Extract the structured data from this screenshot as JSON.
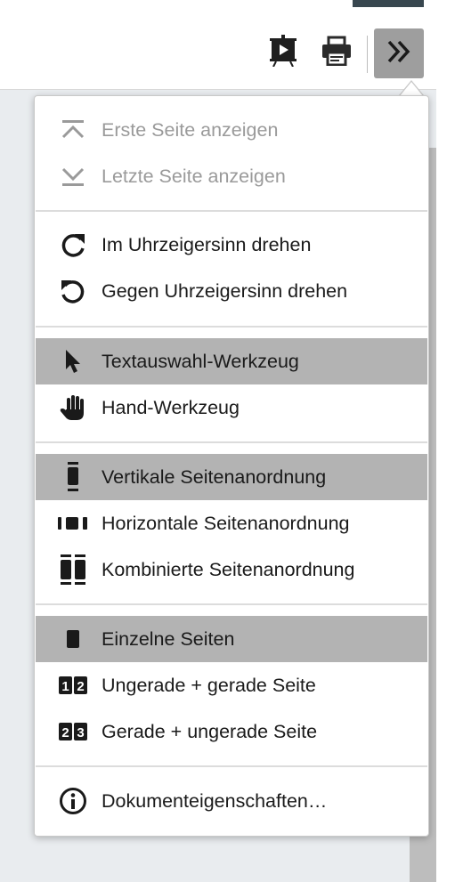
{
  "toolbar": {
    "presentation_icon": "presentation-icon",
    "print_icon": "print-icon",
    "more_icon": "double-chevron-right-icon"
  },
  "menu": {
    "items": [
      {
        "label": "Erste Seite anzeigen",
        "icon": "first-page-icon",
        "disabled": true,
        "active": false
      },
      {
        "label": "Letzte Seite anzeigen",
        "icon": "last-page-icon",
        "disabled": true,
        "active": false
      },
      {
        "label": "Im Uhrzeigersinn drehen",
        "icon": "rotate-clockwise-icon",
        "disabled": false,
        "active": false
      },
      {
        "label": "Gegen Uhrzeigersinn drehen",
        "icon": "rotate-counterclockwise-icon",
        "disabled": false,
        "active": false
      },
      {
        "label": "Textauswahl-Werkzeug",
        "icon": "cursor-arrow-icon",
        "disabled": false,
        "active": true
      },
      {
        "label": "Hand-Werkzeug",
        "icon": "hand-icon",
        "disabled": false,
        "active": false
      },
      {
        "label": "Vertikale Seitenanordnung",
        "icon": "vertical-scroll-icon",
        "disabled": false,
        "active": true
      },
      {
        "label": "Horizontale Seitenanordnung",
        "icon": "horizontal-scroll-icon",
        "disabled": false,
        "active": false
      },
      {
        "label": "Kombinierte Seitenanordnung",
        "icon": "wrapped-scroll-icon",
        "disabled": false,
        "active": false
      },
      {
        "label": "Einzelne Seiten",
        "icon": "single-page-icon",
        "disabled": false,
        "active": true
      },
      {
        "label": "Ungerade + gerade Seite",
        "icon": "odd-spread-icon",
        "disabled": false,
        "active": false
      },
      {
        "label": "Gerade + ungerade Seite",
        "icon": "even-spread-icon",
        "disabled": false,
        "active": false
      },
      {
        "label": "Dokumenteigenschaften…",
        "icon": "info-icon",
        "disabled": false,
        "active": false
      }
    ]
  },
  "colors": {
    "active_bg": "#b3b3b3",
    "disabled_text": "#9a9a9a",
    "icon": "#1a1a1a",
    "more_button_bg": "#9e9e9e"
  }
}
